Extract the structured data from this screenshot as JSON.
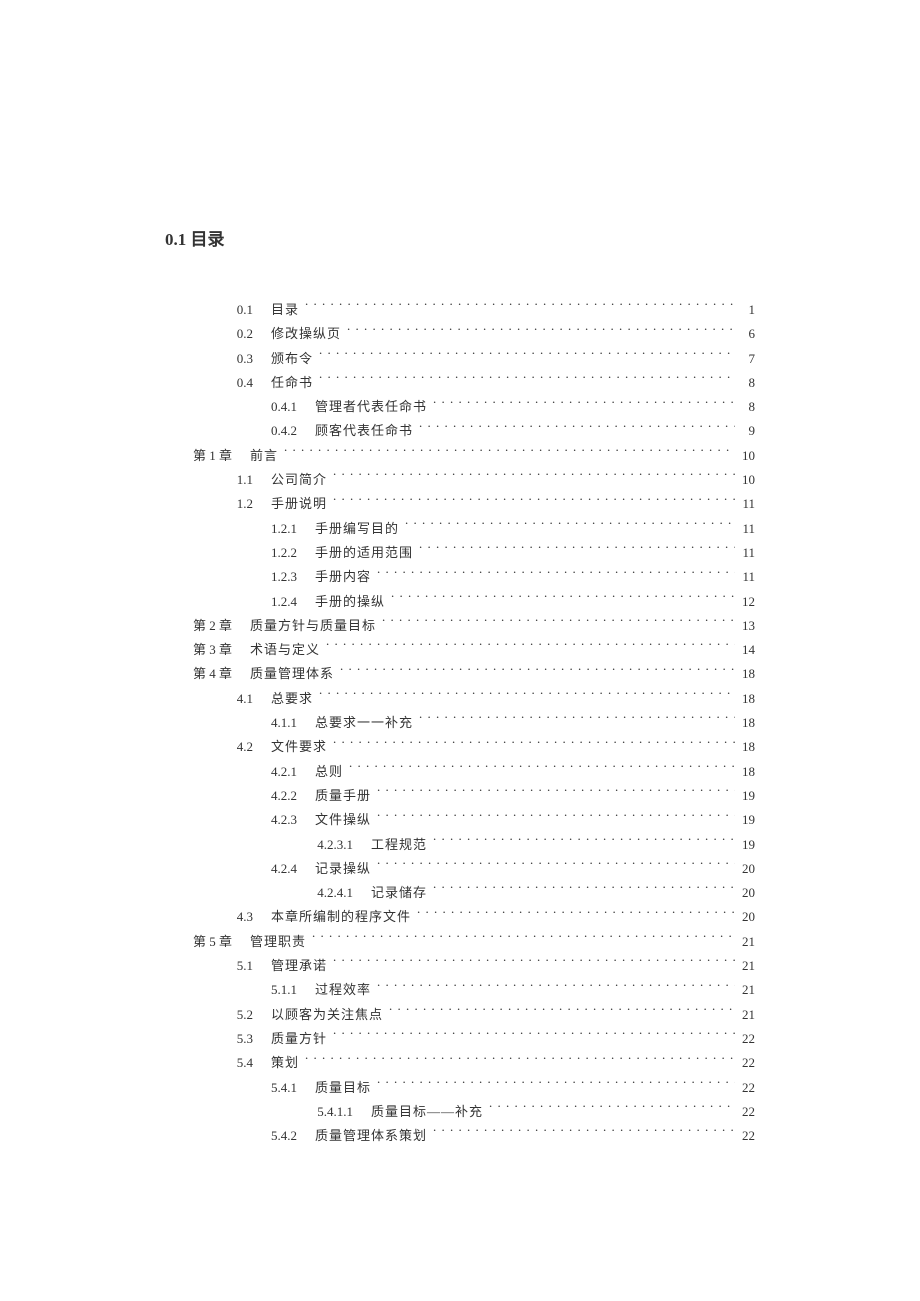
{
  "heading": "0.1 目录",
  "toc": [
    {
      "level": "lvl-1",
      "num": "0.1",
      "title": "目录",
      "page": "1"
    },
    {
      "level": "lvl-1",
      "num": "0.2",
      "title": "修改操纵页",
      "page": "6"
    },
    {
      "level": "lvl-1",
      "num": "0.3",
      "title": "颁布令",
      "page": "7"
    },
    {
      "level": "lvl-1",
      "num": "0.4",
      "title": "任命书",
      "page": "8"
    },
    {
      "level": "lvl-2",
      "num": "0.4.1",
      "title": "管理者代表任命书",
      "page": "8"
    },
    {
      "level": "lvl-2",
      "num": "0.4.2",
      "title": "顾客代表任命书",
      "page": "9"
    },
    {
      "level": "lvl-chapter",
      "num": "第 1 章",
      "title": "前言",
      "page": "10"
    },
    {
      "level": "lvl-1",
      "num": "1.1",
      "title": "公司简介",
      "page": "10"
    },
    {
      "level": "lvl-1",
      "num": "1.2",
      "title": "手册说明",
      "page": "11"
    },
    {
      "level": "lvl-2",
      "num": "1.2.1",
      "title": "手册编写目的",
      "page": "11"
    },
    {
      "level": "lvl-2",
      "num": "1.2.2",
      "title": "手册的适用范围",
      "page": "11"
    },
    {
      "level": "lvl-2",
      "num": "1.2.3",
      "title": "手册内容",
      "page": "11"
    },
    {
      "level": "lvl-2",
      "num": "1.2.4",
      "title": "手册的操纵",
      "page": "12"
    },
    {
      "level": "lvl-chapter",
      "num": "第 2 章",
      "title": "质量方针与质量目标",
      "page": "13"
    },
    {
      "level": "lvl-chapter",
      "num": "第 3 章",
      "title": "术语与定义",
      "page": "14"
    },
    {
      "level": "lvl-chapter",
      "num": "第 4 章",
      "title": "质量管理体系",
      "page": "18"
    },
    {
      "level": "lvl-1",
      "num": "4.1",
      "title": "总要求",
      "page": "18"
    },
    {
      "level": "lvl-2",
      "num": "4.1.1",
      "title": "总要求一一补充",
      "page": "18"
    },
    {
      "level": "lvl-1",
      "num": "4.2",
      "title": "文件要求",
      "page": "18"
    },
    {
      "level": "lvl-2",
      "num": "4.2.1",
      "title": "总则",
      "page": "18"
    },
    {
      "level": "lvl-2",
      "num": "4.2.2",
      "title": "质量手册",
      "page": "19"
    },
    {
      "level": "lvl-2",
      "num": "4.2.3",
      "title": "文件操纵",
      "page": "19"
    },
    {
      "level": "lvl-3",
      "num": "4.2.3.1",
      "title": "工程规范",
      "page": "19"
    },
    {
      "level": "lvl-2",
      "num": "4.2.4",
      "title": "记录操纵",
      "page": "20"
    },
    {
      "level": "lvl-3",
      "num": "4.2.4.1",
      "title": "记录储存",
      "page": "20"
    },
    {
      "level": "lvl-1",
      "num": "4.3",
      "title": "本章所编制的程序文件",
      "page": "20"
    },
    {
      "level": "lvl-chapter",
      "num": "第 5 章",
      "title": "管理职责",
      "page": "21"
    },
    {
      "level": "lvl-1",
      "num": "5.1",
      "title": "管理承诺",
      "page": "21"
    },
    {
      "level": "lvl-2",
      "num": "5.1.1",
      "title": "过程效率",
      "page": "21"
    },
    {
      "level": "lvl-1",
      "num": "5.2",
      "title": "以顾客为关注焦点",
      "page": "21"
    },
    {
      "level": "lvl-1",
      "num": "5.3",
      "title": "质量方针",
      "page": "22"
    },
    {
      "level": "lvl-1",
      "num": "5.4",
      "title": "策划",
      "page": "22"
    },
    {
      "level": "lvl-2",
      "num": "5.4.1",
      "title": "质量目标",
      "page": "22"
    },
    {
      "level": "lvl-3",
      "num": "5.4.1.1",
      "title": "质量目标——补充",
      "page": "22"
    },
    {
      "level": "lvl-2",
      "num": "5.4.2",
      "title": "质量管理体系策划",
      "page": "22"
    }
  ]
}
